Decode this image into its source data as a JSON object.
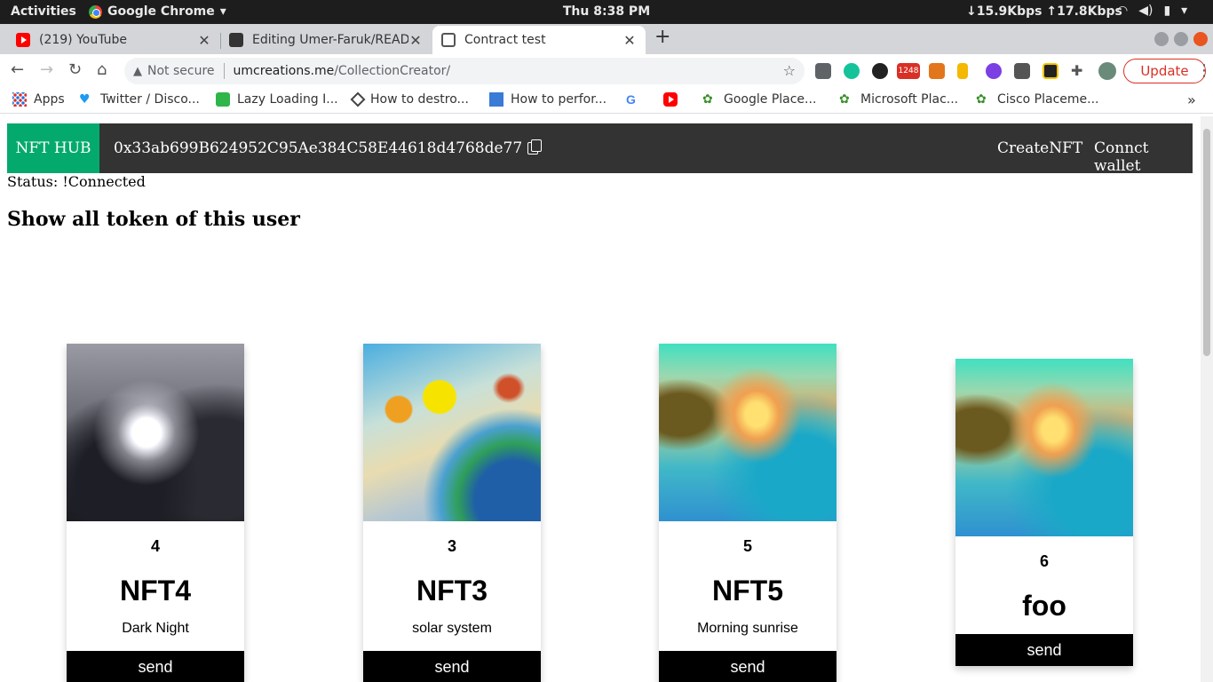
{
  "os": {
    "activities": "Activities",
    "app_name": "Google Chrome",
    "clock": "Thu  8:38 PM",
    "net_speed": "↓15.9Kbps ↑17.8Kbps"
  },
  "browser": {
    "tabs": [
      {
        "label": "(219) YouTube",
        "icon": "youtube-icon"
      },
      {
        "label": "Editing Umer-Faruk/READ",
        "icon": "github-icon"
      },
      {
        "label": "Contract test",
        "icon": "globe-icon"
      }
    ],
    "address": {
      "security": "Not secure",
      "host": "umcreations.me",
      "path": "/CollectionCreator/"
    },
    "update_label": "Update",
    "notification_count": "1248",
    "bookmarks": [
      {
        "label": "Apps"
      },
      {
        "label": "Twitter / Disco..."
      },
      {
        "label": "Lazy Loading I..."
      },
      {
        "label": "How to destro..."
      },
      {
        "label": "How to perfor..."
      },
      {
        "label": ""
      },
      {
        "label": ""
      },
      {
        "label": "Google Place..."
      },
      {
        "label": "Microsoft Plac..."
      },
      {
        "label": "Cisco Placeme..."
      }
    ]
  },
  "page": {
    "brand": "NFT HUB",
    "wallet_address": "0x33ab699B624952C95Ae384C58E44618d4768de77",
    "nav_create": "CreateNFT",
    "nav_connect": "Connct wallet",
    "status": "Status: !Connected",
    "heading": "Show all token of this user",
    "send_label": "send",
    "tokens": [
      {
        "id": "4",
        "name": "NFT4",
        "description": "Dark Night"
      },
      {
        "id": "3",
        "name": "NFT3",
        "description": "solar system"
      },
      {
        "id": "5",
        "name": "NFT5",
        "description": "Morning sunrise"
      },
      {
        "id": "6",
        "name": "foo",
        "description": ""
      }
    ]
  }
}
